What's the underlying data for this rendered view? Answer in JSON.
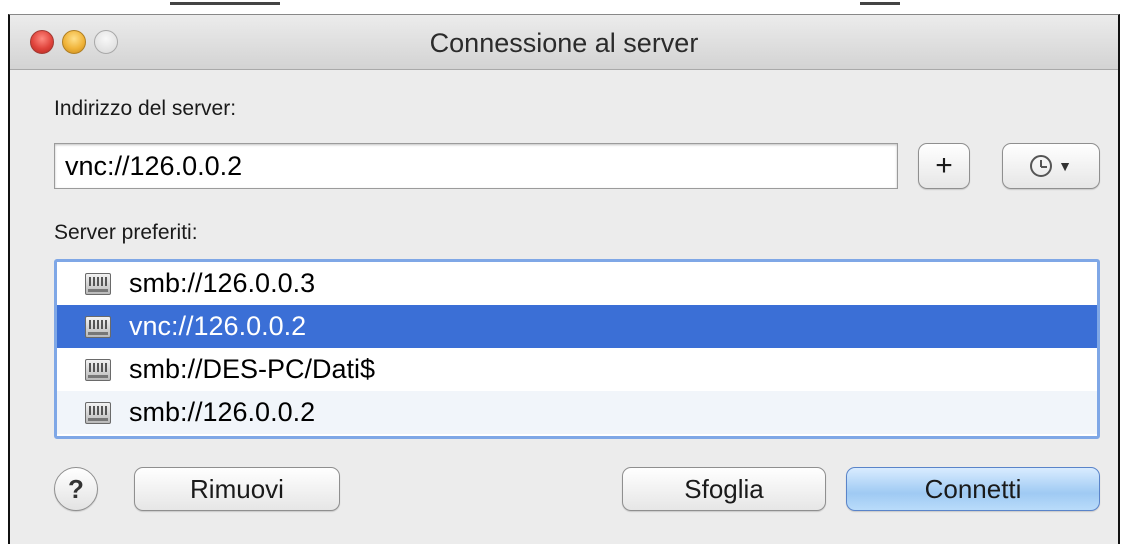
{
  "window": {
    "title": "Connessione al server"
  },
  "server_address": {
    "label": "Indirizzo del server:",
    "value": "vnc://126.0.0.2"
  },
  "buttons": {
    "add": "+",
    "help": "?",
    "remove": "Rimuovi",
    "browse": "Sfoglia",
    "connect": "Connetti"
  },
  "favorites": {
    "label": "Server preferiti:",
    "items": [
      {
        "label": "smb://126.0.0.3",
        "selected": false
      },
      {
        "label": "vnc://126.0.0.2",
        "selected": true
      },
      {
        "label": "smb://DES-PC/Dati$",
        "selected": false
      },
      {
        "label": "smb://126.0.0.2",
        "selected": false
      }
    ]
  },
  "colors": {
    "selection": "#3b6fd6",
    "default_button": "#9fcaf3",
    "focus_ring": "#7fa7e6"
  },
  "icons": [
    "server-icon",
    "clock-icon",
    "chevron-down-icon",
    "help-icon"
  ]
}
